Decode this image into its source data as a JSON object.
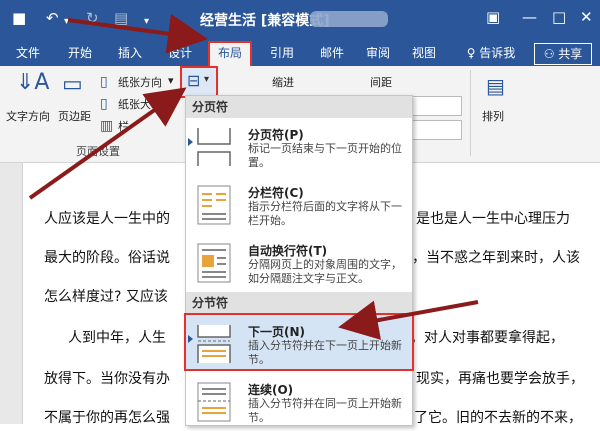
{
  "titlebar": {
    "doc_title": "经营生活 [兼容模式]",
    "save_icon": "floppy-disk-icon",
    "undo_icon": "undo-icon",
    "redo_icon": "redo-icon",
    "minimize": "—",
    "maximize": "□",
    "close": "✕"
  },
  "tabs": [
    {
      "label": "文件"
    },
    {
      "label": "开始"
    },
    {
      "label": "插入"
    },
    {
      "label": "设计"
    },
    {
      "label": "布局"
    },
    {
      "label": "引用"
    },
    {
      "label": "邮件"
    },
    {
      "label": "审阅"
    },
    {
      "label": "视图"
    }
  ],
  "tellme": "告诉我",
  "share": "共享",
  "ribbon": {
    "text_direction": "文字方向",
    "margins": "页边距",
    "orientation": "纸张方向",
    "size": "纸张大小",
    "columns": "栏",
    "group_page_setup": "页面设置",
    "indent": "缩进",
    "spacing": "间距",
    "arrange": "排列"
  },
  "menu": {
    "section_page_breaks": "分页符",
    "section_section_breaks": "分节符",
    "items": [
      {
        "title": "分页符(P)",
        "desc": "标记一页结束与下一页开始的位置。"
      },
      {
        "title": "分栏符(C)",
        "desc": "指示分栏符后面的文字将从下一栏开始。"
      },
      {
        "title": "自动换行符(T)",
        "desc": "分隔网页上的对象周围的文字，如分隔题注文字与正文。"
      },
      {
        "title": "下一页(N)",
        "desc": "插入分节符并在下一页上开始新节。"
      },
      {
        "title": "连续(O)",
        "desc": "插入分节符并在同一页上开始新节。"
      }
    ]
  },
  "doc": {
    "lines": [
      "人应该是人一生中的",
      "是也是人一生中心理压力",
      "最大的阶段。俗话说",
      "，当不惑之年到来时，人该",
      "怎么样度过? 又应该",
      "人到中年，人生",
      "。对人对事都要拿得起，",
      "放得下。当你没有办",
      "现实，再痛也要学会放手，",
      "不属于你的再怎么强",
      "了它。旧的不去新的不来，"
    ]
  }
}
